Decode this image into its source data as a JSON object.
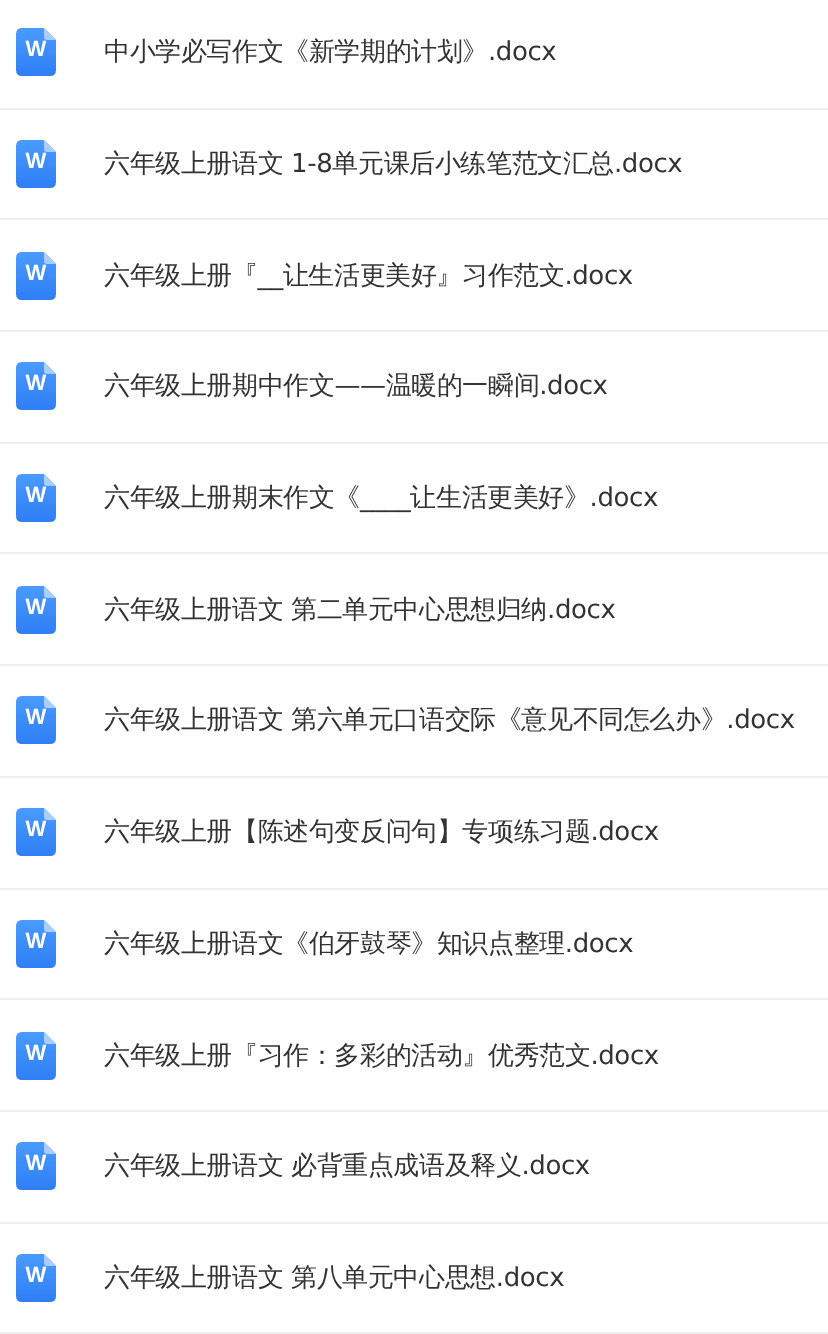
{
  "files": [
    {
      "icon_label": "W",
      "name": "中小学必写作文《新学期的计划》.docx"
    },
    {
      "icon_label": "W",
      "name": "六年级上册语文 1-8单元课后小练笔范文汇总.docx"
    },
    {
      "icon_label": "W",
      "name": "六年级上册『__让生活更美好』习作范文.docx"
    },
    {
      "icon_label": "W",
      "name": "六年级上册期中作文——温暖的一瞬间.docx"
    },
    {
      "icon_label": "W",
      "name": "六年级上册期末作文《____让生活更美好》.docx"
    },
    {
      "icon_label": "W",
      "name": "六年级上册语文 第二单元中心思想归纳.docx"
    },
    {
      "icon_label": "W",
      "name": "六年级上册语文 第六单元口语交际《意见不同怎么办》.docx"
    },
    {
      "icon_label": "W",
      "name": "六年级上册【陈述句变反问句】专项练习题.docx"
    },
    {
      "icon_label": "W",
      "name": "六年级上册语文《伯牙鼓琴》知识点整理.docx"
    },
    {
      "icon_label": "W",
      "name": "六年级上册『习作：多彩的活动』优秀范文.docx"
    },
    {
      "icon_label": "W",
      "name": "六年级上册语文 必背重点成语及释义.docx"
    },
    {
      "icon_label": "W",
      "name": "六年级上册语文 第八单元中心思想.docx"
    }
  ]
}
